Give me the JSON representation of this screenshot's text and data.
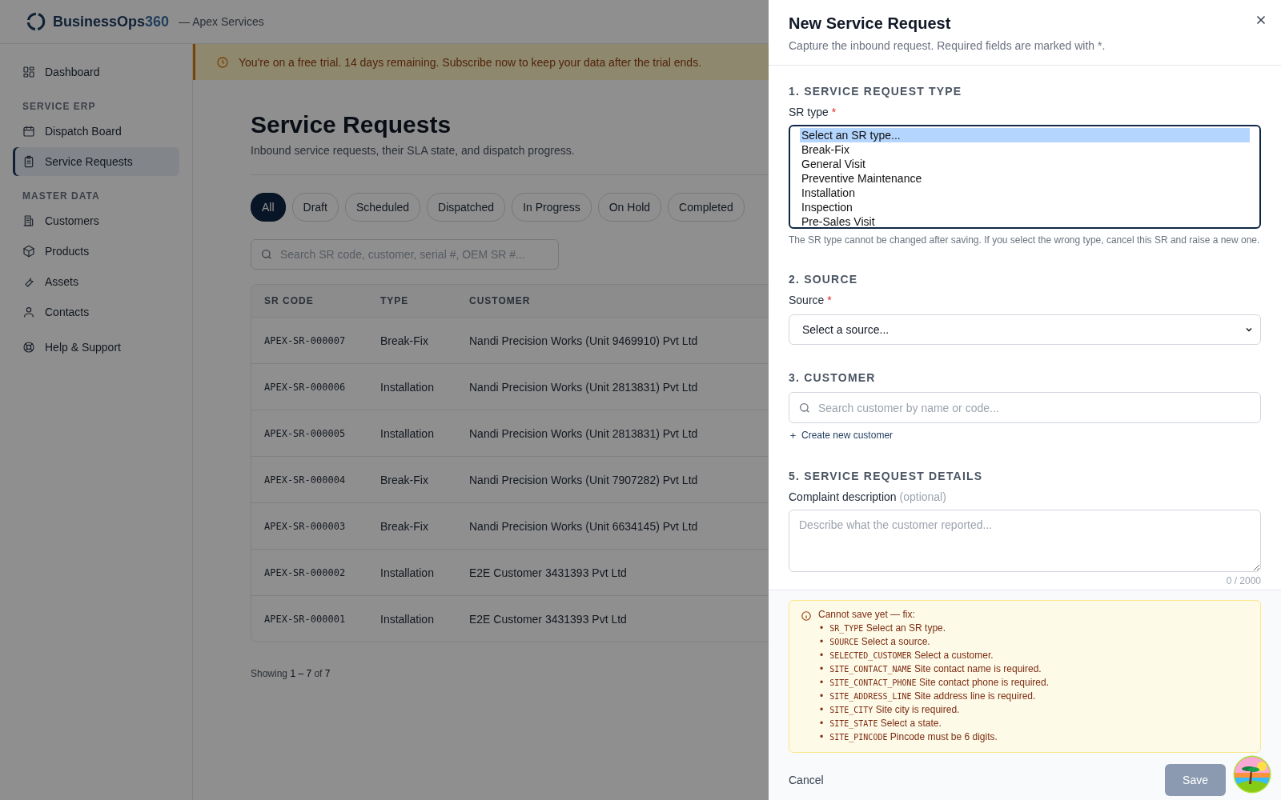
{
  "app": {
    "brand": "BusinessOps",
    "brand_suffix": "360",
    "tenant": "— Apex Services"
  },
  "sidebar": {
    "sections": [
      {
        "items": [
          {
            "label": "Dashboard",
            "selected": false
          }
        ]
      },
      {
        "heading": "SERVICE ERP",
        "items": [
          {
            "label": "Dispatch Board",
            "selected": false
          },
          {
            "label": "Service Requests",
            "selected": true
          }
        ]
      },
      {
        "heading": "MASTER DATA",
        "items": [
          {
            "label": "Customers",
            "selected": false
          },
          {
            "label": "Products",
            "selected": false
          },
          {
            "label": "Assets",
            "selected": false
          },
          {
            "label": "Contacts",
            "selected": false
          }
        ]
      },
      {
        "items": [
          {
            "label": "Help & Support",
            "selected": false
          }
        ]
      }
    ]
  },
  "trial_banner": {
    "text": "You're on a free trial. 14 days remaining. Subscribe now to keep your data after the trial ends."
  },
  "page": {
    "title": "Service Requests",
    "subtitle": "Inbound service requests, their SLA state, and dispatch progress."
  },
  "filters": [
    {
      "label": "All",
      "selected": true
    },
    {
      "label": "Draft",
      "selected": false
    },
    {
      "label": "Scheduled",
      "selected": false
    },
    {
      "label": "Dispatched",
      "selected": false
    },
    {
      "label": "In Progress",
      "selected": false
    },
    {
      "label": "On Hold",
      "selected": false
    },
    {
      "label": "Completed",
      "selected": false
    }
  ],
  "search": {
    "placeholder": "Search SR code, customer, serial #, OEM SR #..."
  },
  "table": {
    "columns": [
      "SR CODE",
      "TYPE",
      "CUSTOMER"
    ],
    "rows": [
      [
        "APEX-SR-000007",
        "Break-Fix",
        "Nandi Precision Works (Unit 9469910) Pvt Ltd"
      ],
      [
        "APEX-SR-000006",
        "Installation",
        "Nandi Precision Works (Unit 2813831) Pvt Ltd"
      ],
      [
        "APEX-SR-000005",
        "Installation",
        "Nandi Precision Works (Unit 2813831) Pvt Ltd"
      ],
      [
        "APEX-SR-000004",
        "Break-Fix",
        "Nandi Precision Works (Unit 7907282) Pvt Ltd"
      ],
      [
        "APEX-SR-000003",
        "Break-Fix",
        "Nandi Precision Works (Unit 6634145) Pvt Ltd"
      ],
      [
        "APEX-SR-000002",
        "Installation",
        "E2E Customer 3431393 Pvt Ltd"
      ],
      [
        "APEX-SR-000001",
        "Installation",
        "E2E Customer 3431393 Pvt Ltd"
      ]
    ]
  },
  "pagination": "Showing **1 – 7** of **7**",
  "drawer": {
    "title": "New Service Request",
    "subtitle": "Capture the inbound request. Required fields are marked with *.",
    "sr_type": {
      "heading": "1. SERVICE REQUEST TYPE",
      "label": "SR type",
      "required_mark": "*",
      "options": [
        {
          "label": "Select an SR type...",
          "selected": true
        },
        {
          "label": "Break-Fix",
          "selected": false
        },
        {
          "label": "General Visit",
          "selected": false
        },
        {
          "label": "Preventive Maintenance",
          "selected": false
        },
        {
          "label": "Installation",
          "selected": false
        },
        {
          "label": "Inspection",
          "selected": false
        },
        {
          "label": "Pre-Sales Visit",
          "selected": false
        }
      ],
      "hint": "The SR type cannot be changed after saving. If you select the wrong type, cancel this SR and raise a new one."
    },
    "source": {
      "heading": "2. SOURCE",
      "label": "Source",
      "required_mark": "*",
      "value": "Select a source..."
    },
    "customer": {
      "heading": "3. CUSTOMER",
      "placeholder": "Search customer by name or code...",
      "create_link": "Create new customer"
    },
    "details": {
      "heading": "5. SERVICE REQUEST DETAILS",
      "label": "Complaint description",
      "label_note": "(optional)",
      "placeholder": "Describe what the customer reported...",
      "counter": "0 / 2000"
    },
    "errors": {
      "title": "Cannot save yet — fix:",
      "bullet": "•",
      "items": [
        {
          "code": "SR_TYPE",
          "message": "Select an SR type."
        },
        {
          "code": "SOURCE",
          "message": "Select a source."
        },
        {
          "code": "SELECTED_CUSTOMER",
          "message": "Select a customer."
        },
        {
          "code": "SITE_CONTACT_NAME",
          "message": "Site contact name is required."
        },
        {
          "code": "SITE_CONTACT_PHONE",
          "message": "Site contact phone is required."
        },
        {
          "code": "SITE_ADDRESS_LINE",
          "message": "Site address line is required."
        },
        {
          "code": "SITE_CITY",
          "message": "Site city is required."
        },
        {
          "code": "SITE_STATE",
          "message": "Select a state."
        },
        {
          "code": "SITE_PINCODE",
          "message": "Pincode must be 6 digits."
        }
      ]
    },
    "footer": {
      "cancel": "Cancel",
      "save": "Save",
      "save_disabled": true
    }
  }
}
